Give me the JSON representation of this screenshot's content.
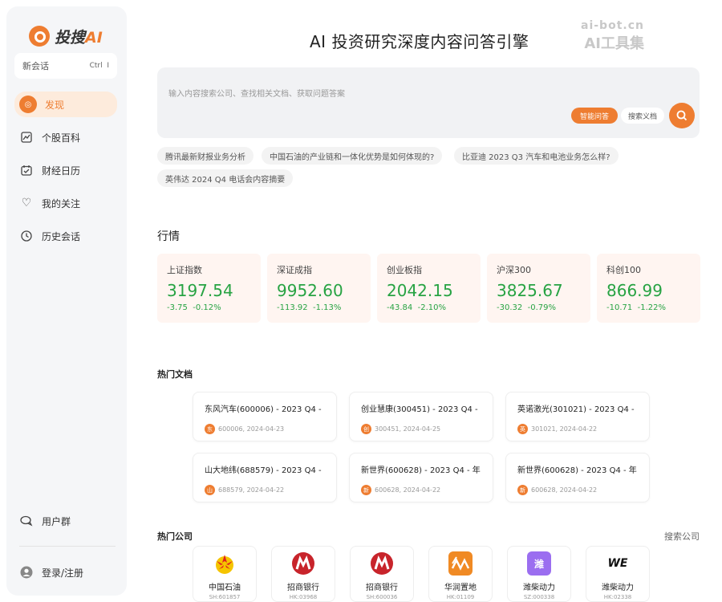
{
  "brand": {
    "name": "投搜",
    "suffix": "AI"
  },
  "sidebar": {
    "new_chat": "新会话",
    "shortcut": "Ctrl",
    "shortcut2": "I",
    "items": [
      {
        "label": "发现",
        "icon": "discover-icon",
        "active": true
      },
      {
        "label": "个股百科",
        "icon": "chart-icon",
        "active": false
      },
      {
        "label": "财经日历",
        "icon": "calendar-icon",
        "active": false
      },
      {
        "label": "我的关注",
        "icon": "heart-icon",
        "active": false
      },
      {
        "label": "历史会话",
        "icon": "clock-icon",
        "active": false
      }
    ],
    "user_group": "用户群",
    "login": "登录/注册"
  },
  "header": {
    "title": "AI 投资研究深度内容问答引擎",
    "watermark_line1": "ai-bot.cn",
    "watermark_line2": "AI工具集"
  },
  "search": {
    "placeholder": "输入内容搜索公司、查找相关文档、获取问题答案",
    "mode_smart": "智能问答",
    "mode_doc": "搜索义档"
  },
  "suggestions": [
    "腾讯最新财报业务分析",
    "中国石油的产业链和一体化优势是如何体现的?",
    "比亚迪 2023 Q3 汽车和电池业务怎么样?",
    "英伟达 2024 Q4 电话会内容摘要"
  ],
  "market": {
    "title": "行情",
    "cards": [
      {
        "name": "上证指数",
        "value": "3197.54",
        "change": "-3.75",
        "pct": "-0.12%"
      },
      {
        "name": "深证成指",
        "value": "9952.60",
        "change": "-113.92",
        "pct": "-1.13%"
      },
      {
        "name": "创业板指",
        "value": "2042.15",
        "change": "-43.84",
        "pct": "-2.10%"
      },
      {
        "name": "沪深300",
        "value": "3825.67",
        "change": "-30.32",
        "pct": "-0.79%"
      },
      {
        "name": "科创100",
        "value": "866.99",
        "change": "-10.71",
        "pct": "-1.22%"
      }
    ],
    "up_color": "#27a343"
  },
  "hot_docs": {
    "title": "热门文档",
    "items": [
      {
        "title": "东风汽车(600006) - 2023 Q4 -",
        "badge": "东",
        "meta": "600006, 2024-04-23"
      },
      {
        "title": "创业慧康(300451) - 2023 Q4 -",
        "badge": "创",
        "meta": "300451, 2024-04-25"
      },
      {
        "title": "英诺激光(301021) - 2023 Q4 -",
        "badge": "英",
        "meta": "301021, 2024-04-22"
      },
      {
        "title": "山大地纬(688579) - 2023 Q4 -",
        "badge": "山",
        "meta": "688579, 2024-04-22"
      },
      {
        "title": "新世界(600628) - 2023 Q4 - 年",
        "badge": "新",
        "meta": "600628, 2024-04-22"
      },
      {
        "title": "新世界(600628) - 2023 Q4 - 年",
        "badge": "新",
        "meta": "600628, 2024-04-22"
      }
    ]
  },
  "hot_companies": {
    "title": "热门公司",
    "search_label": "搜索公司",
    "items": [
      {
        "name": "中国石油",
        "code": "SH:601857",
        "logo": "petrochina-logo",
        "color": "#e02020",
        "glyph": ""
      },
      {
        "name": "招商银行",
        "code": "HK:03968",
        "logo": "cmb-logo",
        "color": "#c8242b",
        "glyph": ""
      },
      {
        "name": "招商银行",
        "code": "SH:600036",
        "logo": "cmb-logo",
        "color": "#c8242b",
        "glyph": ""
      },
      {
        "name": "华润置地",
        "code": "HK:01109",
        "logo": "cr-land-logo",
        "color": "#f08a24",
        "glyph": ""
      },
      {
        "name": "潍柴动力",
        "code": "SZ:000338",
        "logo": "weichai-logo",
        "color": "#9b6ef0",
        "glyph": "潍"
      },
      {
        "name": "潍柴动力",
        "code": "HK:02338",
        "logo": "weichai-we-logo",
        "color": "#ffffff",
        "glyph": "WE"
      }
    ]
  }
}
